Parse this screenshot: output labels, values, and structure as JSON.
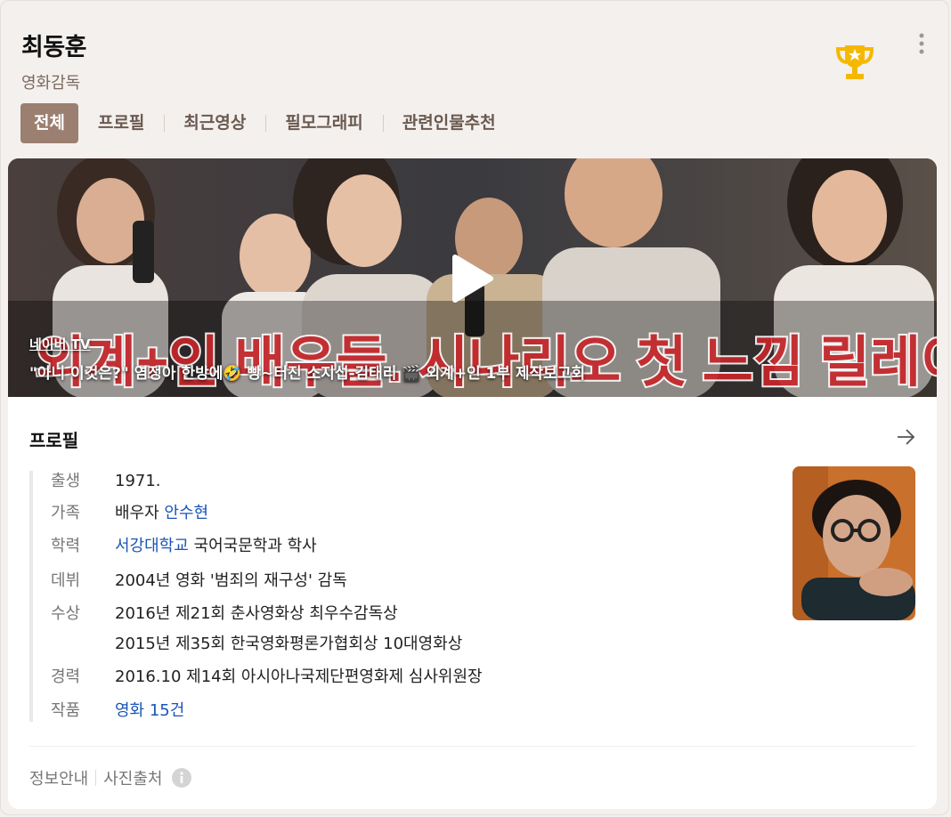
{
  "header": {
    "name": "최동훈",
    "occupation": "영화감독",
    "trophy_icon": "trophy-icon",
    "more_icon": "more-vertical-icon"
  },
  "tabs": [
    {
      "label": "전체",
      "active": true
    },
    {
      "label": "프로필"
    },
    {
      "label": "최근영상"
    },
    {
      "label": "필모그래피"
    },
    {
      "label": "관련인물추천"
    }
  ],
  "video": {
    "source": "네이버 TV",
    "title": "\"아니 이것은?\" 염정아 한방에🤣 빵~터진 소지섭-김태리 🎬 외계+인 1부 제작보고회",
    "caption_overlay": "외계+인 배우들. 시나리오 첫 느낌 릴레이"
  },
  "profile": {
    "title": "프로필",
    "rows": [
      {
        "label": "출생",
        "value": "1971."
      },
      {
        "label": "가족",
        "prefix": "배우자 ",
        "link": "안수현"
      },
      {
        "label": "학력",
        "link": "서강대학교",
        "suffix": " 국어국문학과 학사"
      },
      {
        "label": "데뷔",
        "value": "2004년 영화 '범죄의 재구성' 감독"
      },
      {
        "label": "수상",
        "value": "2016년 제21회 춘사영화상 최우수감독상"
      },
      {
        "label": "",
        "value": "2015년 제35회 한국영화평론가협회상 10대영화상"
      },
      {
        "label": "경력",
        "value": "2016.10 제14회 아시아나국제단편영화제 심사위원장"
      },
      {
        "label": "작품",
        "link": "영화 15건"
      }
    ]
  },
  "footer": {
    "info_guide": "정보안내",
    "photo_source": "사진출처"
  },
  "colors": {
    "accent_tab": "#9b7f70",
    "link": "#1a55b8",
    "trophy": "#f5b800"
  }
}
